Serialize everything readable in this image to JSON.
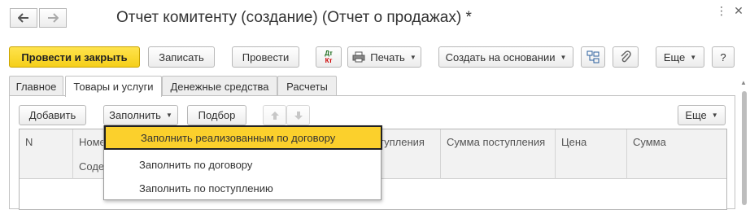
{
  "window": {
    "title": "Отчет комитенту (создание) (Отчет о продажах) *",
    "more_icon": "more-vert-icon",
    "close_icon": "close-icon"
  },
  "nav": {
    "back_icon": "arrow-left-icon",
    "forward_icon": "arrow-right-icon"
  },
  "toolbar": {
    "post_and_close": "Провести и закрыть",
    "save": "Записать",
    "post": "Провести",
    "dt_kt_top": "Дт",
    "dt_kt_bottom": "Кт",
    "print": "Печать",
    "create_based_on": "Создать на основании",
    "more": "Еще",
    "help": "?"
  },
  "tabs": [
    {
      "label": "Главное",
      "active": false
    },
    {
      "label": "Товары и услуги",
      "active": true
    },
    {
      "label": "Денежные средства",
      "active": false
    },
    {
      "label": "Расчеты",
      "active": false
    }
  ],
  "table_toolbar": {
    "add": "Добавить",
    "fill": "Заполнить",
    "select": "Подбор",
    "more": "Еще"
  },
  "grid": {
    "columns": [
      "N",
      "Номе",
      "тупления",
      "Сумма поступления",
      "Цена",
      "Сумма"
    ],
    "subheader": "Соде"
  },
  "dropdown": {
    "items": [
      {
        "label": "Заполнить реализованным по договору",
        "selected": true
      },
      {
        "label": "Заполнить по договору",
        "selected": false
      },
      {
        "label": "Заполнить по поступлению",
        "selected": false
      }
    ]
  },
  "colors": {
    "accent_yellow": "#f5cf1a",
    "selected_item": "#fbd02c",
    "border": "#b8b8b8"
  }
}
